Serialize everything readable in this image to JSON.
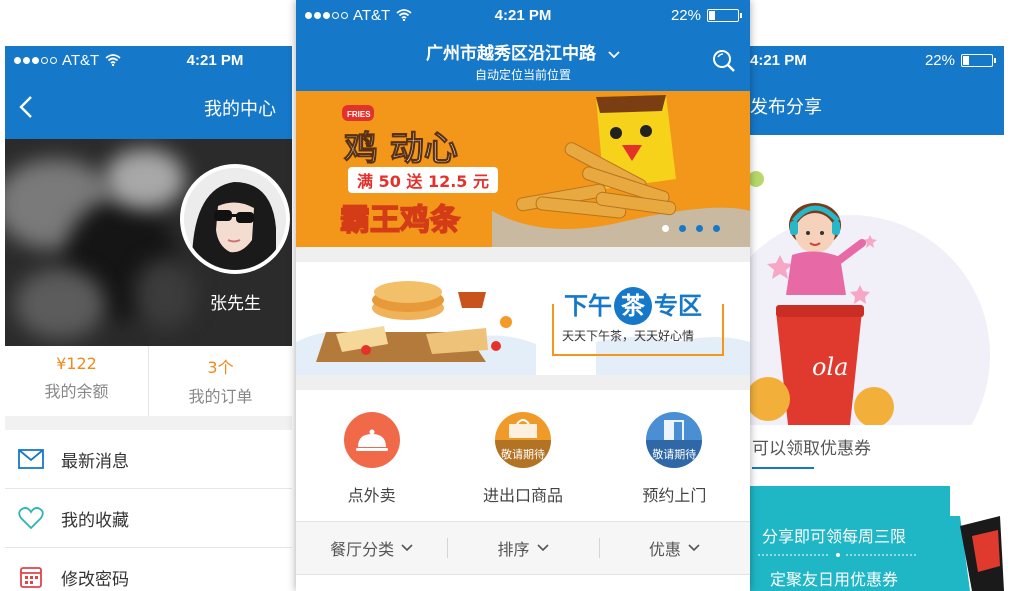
{
  "left_screen": {
    "status": {
      "carrier": "AT&T",
      "time": "4:21 PM"
    },
    "title": "我的中心",
    "username": "张先生",
    "stats": [
      {
        "value": "¥122",
        "label": "我的余额"
      },
      {
        "value": "3个",
        "label": "我的订单"
      }
    ],
    "menu": [
      {
        "icon": "mail-icon",
        "label": "最新消息"
      },
      {
        "icon": "heart-icon",
        "label": "我的收藏"
      },
      {
        "icon": "calendar-icon",
        "label": "修改密码"
      }
    ]
  },
  "center_screen": {
    "status": {
      "carrier": "AT&T",
      "time": "4:21 PM",
      "battery": "22%"
    },
    "location": "广州市越秀区沿江中路",
    "location_sub": "自动定位当前位置",
    "banner": {
      "title": "鸡 动心",
      "promo": "满 50 送 12.5 元",
      "subtitle": "霸王鸡条",
      "box_text": "FRIES",
      "slide_count": 4,
      "active_slide": 1
    },
    "tea": {
      "title_pre": "下午",
      "title_mid": "茶",
      "title_post": "专区",
      "slogan": "天天下午茶，天天好心情"
    },
    "categories": [
      {
        "label": "点外卖",
        "badge": "",
        "color": "#f06a4a",
        "icon": "cloche-icon"
      },
      {
        "label": "进出口商品",
        "badge": "敬请期待",
        "color": "#f09a2a",
        "icon": "bag-icon"
      },
      {
        "label": "预约上门",
        "badge": "敬请期待",
        "color": "#4a8fd4",
        "icon": "door-icon"
      }
    ],
    "filters": [
      "餐厅分类",
      "排序",
      "优惠"
    ]
  },
  "right_screen": {
    "status": {
      "time": "4:21 PM",
      "battery": "22%"
    },
    "title": "发布分享",
    "coupon_text": "可以领取优惠券",
    "cola_text": "ola",
    "ticket_line1": "分享即可领每周三限",
    "ticket_line2": "定聚友日用优惠券"
  },
  "colors": {
    "primary": "#1678c8",
    "orange": "#f3971b",
    "price": "#f08a1c"
  }
}
